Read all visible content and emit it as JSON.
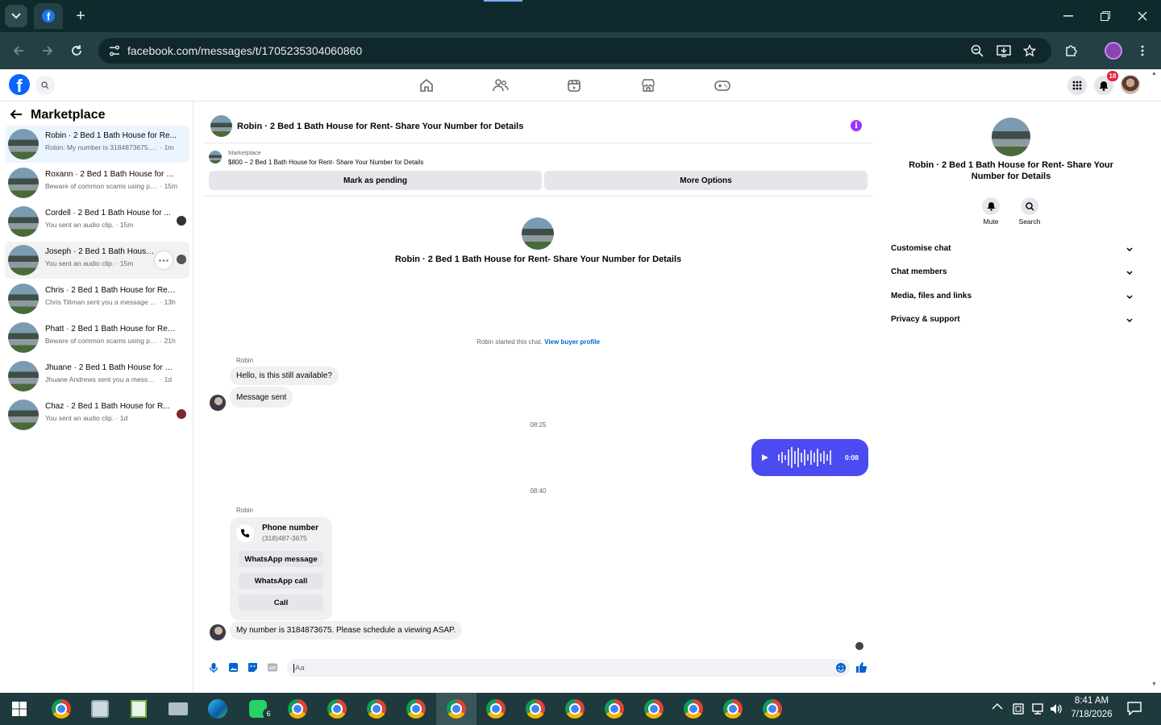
{
  "browser": {
    "url": "facebook.com/messages/t/1705235304060860"
  },
  "header": {
    "notifications_badge": "18"
  },
  "left": {
    "title": "Marketplace",
    "conversations": [
      {
        "name": "Robin · 2 Bed 1 Bath House for Re...",
        "preview": "Robin: My number is 3184873675. Pl...",
        "time": "· 1m"
      },
      {
        "name": "Roxann · 2 Bed 1 Bath House for R...",
        "preview": "Beware of common scams using pa...",
        "time": "· 15m"
      },
      {
        "name": "Cordell · 2 Bed 1 Bath House for ...",
        "preview": "You sent an audio clip.",
        "time": "· 15m"
      },
      {
        "name": "Joseph · 2 Bed 1 Bath House for...",
        "preview": "You sent an audio clip.",
        "time": "· 15m"
      },
      {
        "name": "Chris · 2 Bed 1 Bath House for Rent...",
        "preview": "Chris Tillman sent you a message ab...",
        "time": "· 13h"
      },
      {
        "name": "Phatt · 2 Bed 1 Bath House for Ren...",
        "preview": "Beware of common scams using pay...",
        "time": "· 21h"
      },
      {
        "name": "Jhuane · 2 Bed 1 Bath House for Re...",
        "preview": "Jhuane Andrews sent you a message ...",
        "time": "· 1d"
      },
      {
        "name": "Chaz · 2 Bed 1 Bath House for R...",
        "preview": "You sent an audio clip.",
        "time": "· 1d"
      }
    ]
  },
  "chat": {
    "title": "Robin · 2 Bed 1 Bath House for Rent- Share Your Number for Details",
    "listing_source": "Marketplace",
    "listing": "$800 – 2 Bed 1 Bath House for Rent- Share Your Number for Details",
    "btn_pending": "Mark as pending",
    "btn_more": "More Options",
    "intro_name": "Robin · 2 Bed 1 Bath House for Rent- Share Your Number for Details",
    "started": "Robin started this chat.",
    "view_profile": "View buyer profile",
    "sender1": "Robin",
    "msg1": "Hello, is this still available?",
    "msg2": "Message sent",
    "time1": "08:25",
    "audio_duration": "0:08",
    "time2": "08:40",
    "sender2": "Robin",
    "phone_label": "Phone number",
    "phone_value": "(318)487-3675",
    "wa_message": "WhatsApp message",
    "wa_call": "WhatsApp call",
    "call": "Call",
    "msg3": "My number is 3184873675.  Please schedule a viewing ASAP.",
    "composer_placeholder": "Aa"
  },
  "right": {
    "title": "Robin · 2 Bed 1 Bath House for Rent- Share Your Number for Details",
    "mute": "Mute",
    "search": "Search",
    "sections": [
      "Customise chat",
      "Chat members",
      "Media, files and links",
      "Privacy & support"
    ]
  },
  "taskbar": {
    "whatsapp_badge": "6",
    "time": "8:41 AM",
    "date": "7/18/2026"
  }
}
